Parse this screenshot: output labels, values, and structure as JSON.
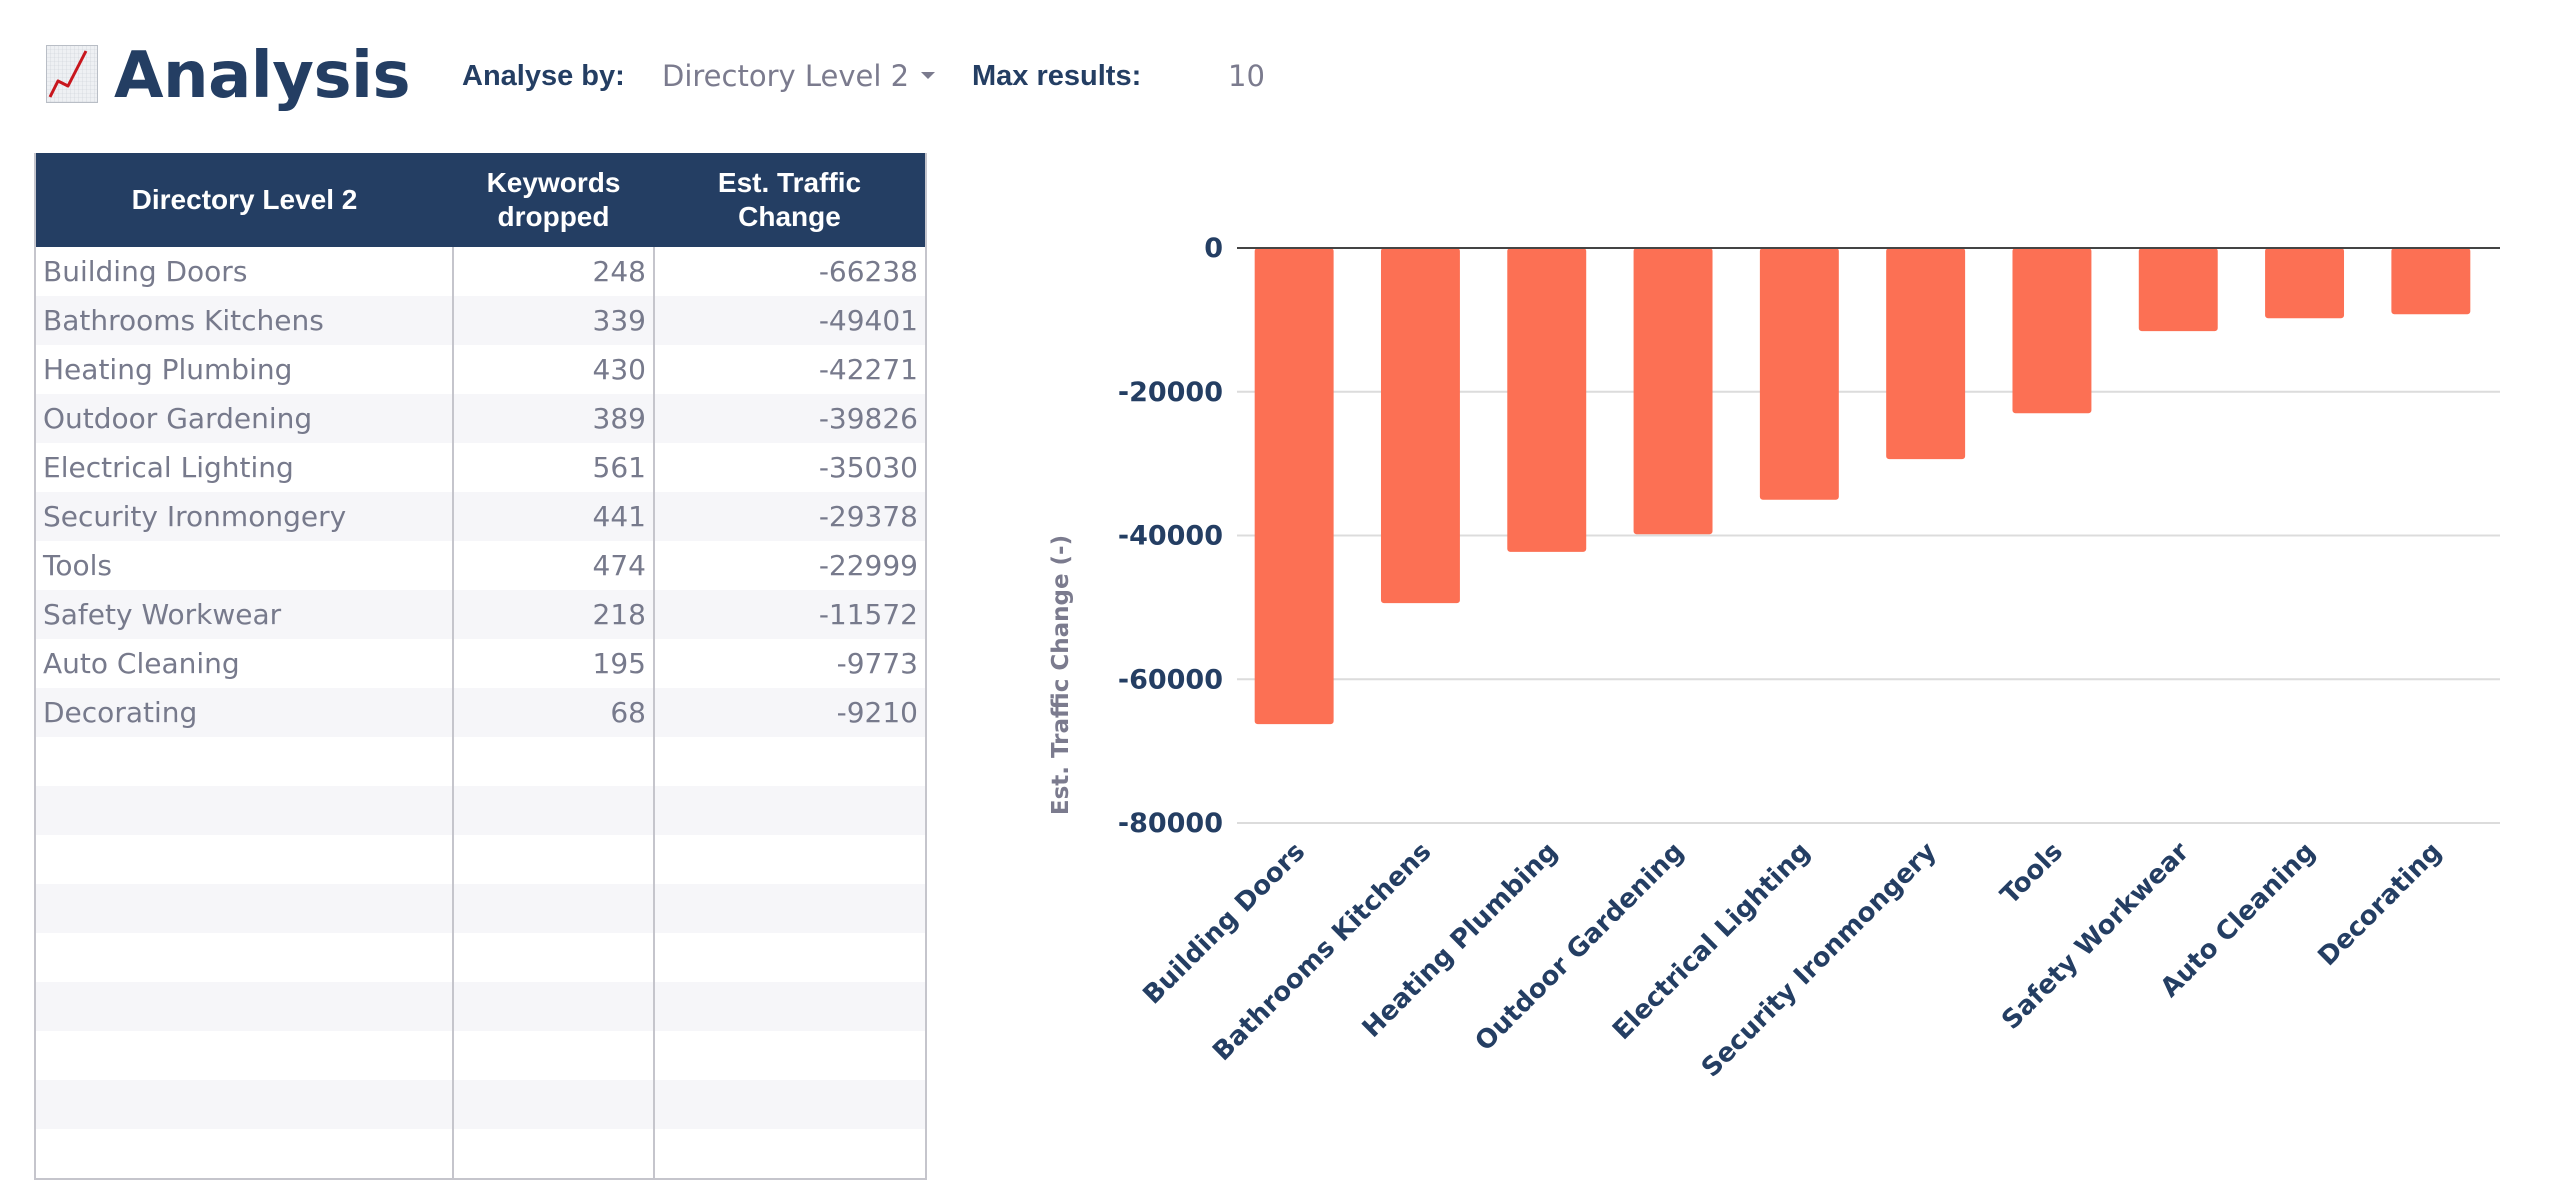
{
  "header": {
    "title": "Analysis",
    "title_icon": "chart-increasing-icon",
    "analyse_by_label": "Analyse by:",
    "analyse_by_value": "Directory Level 2",
    "max_results_label": "Max results:",
    "max_results_value": "10"
  },
  "table": {
    "columns": [
      "Directory Level 2",
      "Keywords dropped",
      "Est. Traffic Change"
    ],
    "column_lines": [
      [
        "Directory Level 2"
      ],
      [
        "Keywords",
        "dropped"
      ],
      [
        "Est. Traffic",
        "Change"
      ]
    ],
    "rows": [
      [
        "Building Doors",
        "248",
        "-66238"
      ],
      [
        "Bathrooms Kitchens",
        "339",
        "-49401"
      ],
      [
        "Heating Plumbing",
        "430",
        "-42271"
      ],
      [
        "Outdoor Gardening",
        "389",
        "-39826"
      ],
      [
        "Electrical Lighting",
        "561",
        "-35030"
      ],
      [
        "Security Ironmongery",
        "441",
        "-29378"
      ],
      [
        "Tools",
        "474",
        "-22999"
      ],
      [
        "Safety Workwear",
        "218",
        "-11572"
      ],
      [
        "Auto Cleaning",
        "195",
        "-9773"
      ],
      [
        "Decorating",
        "68",
        "-9210"
      ]
    ],
    "empty_rows": 9
  },
  "colors": {
    "navy": "#243e63",
    "bar": "#fc7054",
    "muted_text": "#777a8c",
    "axis_title": "#7b7b8e"
  },
  "chart_data": {
    "type": "bar",
    "title": "",
    "xlabel": "",
    "ylabel": "Est. Traffic Change (-)",
    "categories": [
      "Building Doors",
      "Bathrooms Kitchens",
      "Heating Plumbing",
      "Outdoor Gardening",
      "Electrical Lighting",
      "Security Ironmongery",
      "Tools",
      "Safety Workwear",
      "Auto Cleaning",
      "Decorating"
    ],
    "values": [
      -66238,
      -49401,
      -42271,
      -39826,
      -35030,
      -29378,
      -22999,
      -11572,
      -9773,
      -9210
    ],
    "ylim": [
      -80000,
      0
    ],
    "yticks": [
      0,
      -20000,
      -40000,
      -60000,
      -80000
    ],
    "grid": true,
    "legend": "none",
    "xtick_rotation_deg": -45
  }
}
